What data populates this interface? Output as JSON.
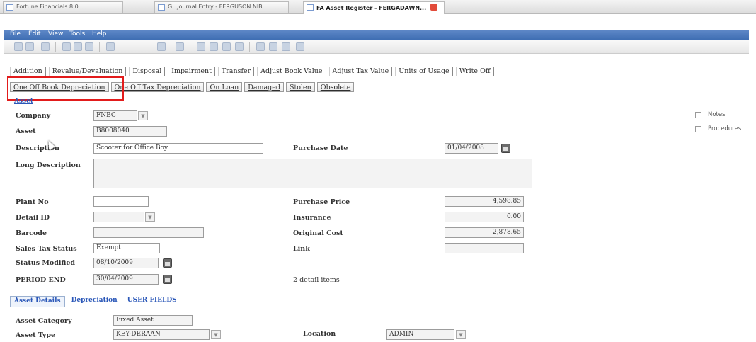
{
  "browser_tabs": [
    {
      "label": "Fortune Financials 8.0"
    },
    {
      "label": "GL Journal Entry - FERGUSON NIB"
    },
    {
      "label": "FA Asset Register - FERGADAWN...",
      "active": true
    }
  ],
  "menu": [
    "File",
    "Edit",
    "View",
    "Tools",
    "Help"
  ],
  "actions_row1": [
    "Addition",
    "Revalue/Devaluation",
    "Disposal",
    "Impairment",
    "Transfer",
    "Adjust Book Value",
    "Adjust Tax Value",
    "Units of Usage",
    "Write Off"
  ],
  "actions_row2": [
    "One Off Book Depreciation",
    "One Off Tax Depreciation",
    "On Loan",
    "Damaged",
    "Stolen",
    "Obsolete"
  ],
  "section_link": "Asset",
  "form": {
    "company_label": "Company",
    "company_value": "FNBC",
    "asset_label": "Asset",
    "asset_value": "B8008040",
    "description_label": "Description",
    "description_value": "Scooter for Office Boy",
    "long_description_label": "Long Description",
    "long_description_value": "",
    "plant_no_label": "Plant No",
    "plant_no_value": "",
    "detail_id_label": "Detail ID",
    "detail_id_value": "",
    "barcode_label": "Barcode",
    "barcode_value": "",
    "sales_tax_status_label": "Sales Tax Status",
    "sales_tax_status_value": "Exempt",
    "status_modified_label": "Status Modified",
    "status_modified_value": "08/10/2009",
    "period_end_label": "PERIOD END",
    "period_end_value": "30/04/2009",
    "purchase_date_label": "Purchase Date",
    "purchase_date_value": "01/04/2008",
    "purchase_price_label": "Purchase Price",
    "purchase_price_value": "4,598.85",
    "insurance_label": "Insurance",
    "insurance_value": "0.00",
    "original_cost_label": "Original Cost",
    "original_cost_value": "2,878.65",
    "link_label": "Link",
    "link_value": "",
    "detail_items": "2 detail items"
  },
  "checkboxes": [
    {
      "label": "Notes",
      "checked": false
    },
    {
      "label": "Procedures",
      "checked": false
    }
  ],
  "bottom_tabs": [
    {
      "label": "Asset Details",
      "active": true
    },
    {
      "label": "Depreciation",
      "active": false
    },
    {
      "label": "USER FIELDS",
      "active": false
    }
  ],
  "details": {
    "asset_category_label": "Asset Category",
    "asset_category_value": "Fixed Asset",
    "asset_type_label": "Asset Type",
    "asset_type_value": "KEY-DERAAN",
    "location_label": "Location",
    "location_value": "ADMIN"
  },
  "colors": {
    "menu_bar": "#4a78bd",
    "highlight": "#e21b1b",
    "link": "#2a57b8"
  }
}
